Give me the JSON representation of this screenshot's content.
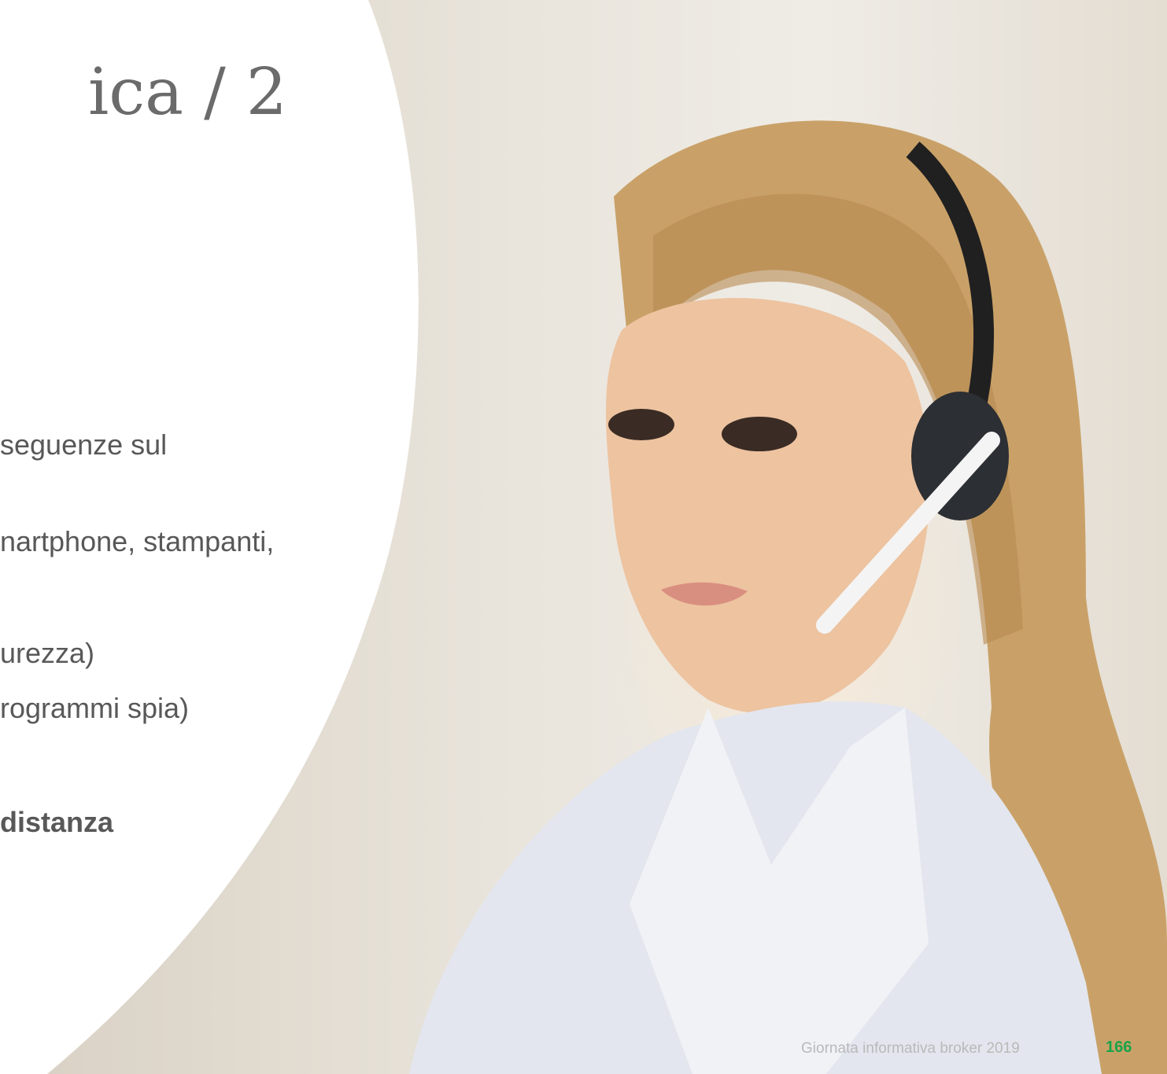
{
  "slide": {
    "title": "ica / 2",
    "bullets": [
      {
        "text": "seguenze sul",
        "bold": false
      },
      {
        "text": "nartphone, stampanti,",
        "bold": false
      },
      {
        "text": "urezza)",
        "bold": false
      },
      {
        "text": "rogrammi spia)",
        "bold": false
      },
      {
        "text": "distanza",
        "bold": true
      }
    ],
    "footer": {
      "event": "Giornata informativa broker 2019",
      "page_number": "166"
    },
    "colors": {
      "title": "#6b6b6b",
      "body_text": "#585858",
      "footer_text": "#b9b9b9",
      "page_number": "#19a34a"
    },
    "photo": "woman-with-headset"
  }
}
